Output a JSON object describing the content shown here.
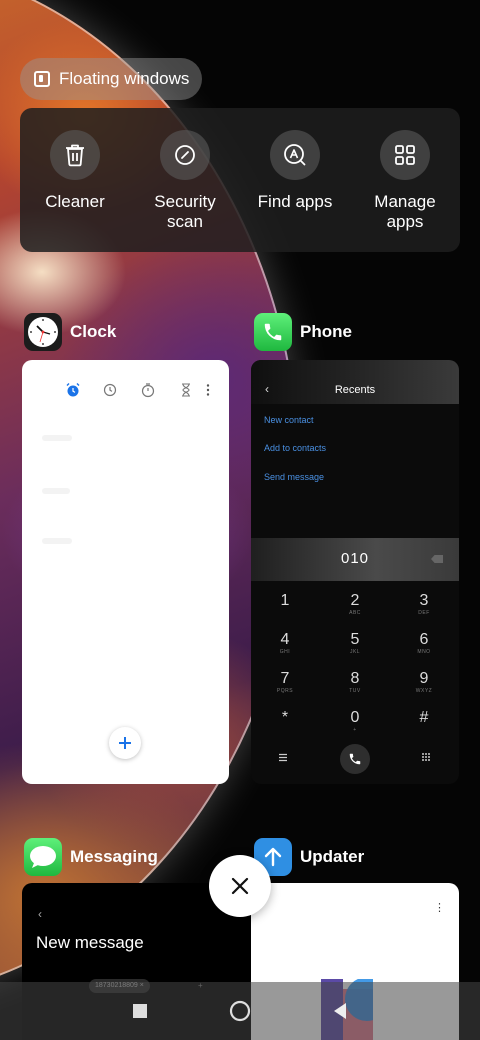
{
  "floating_windows": {
    "label": "Floating windows"
  },
  "quick_actions": [
    {
      "label": "Cleaner",
      "icon": "trash-icon"
    },
    {
      "label": "Security\nscan",
      "icon": "security-scan-icon"
    },
    {
      "label": "Find apps",
      "icon": "find-apps-icon"
    },
    {
      "label": "Manage\napps",
      "icon": "grid-icon"
    }
  ],
  "recent_apps": {
    "clock": {
      "title": "Clock"
    },
    "phone": {
      "title": "Phone",
      "screen_title": "Recents",
      "links": [
        "New contact",
        "Add to contacts",
        "Send message"
      ],
      "dialed_number": "010",
      "keypad": [
        {
          "num": "1",
          "letters": ""
        },
        {
          "num": "2",
          "letters": "ABC"
        },
        {
          "num": "3",
          "letters": "DEF"
        },
        {
          "num": "4",
          "letters": "GHI"
        },
        {
          "num": "5",
          "letters": "JKL"
        },
        {
          "num": "6",
          "letters": "MNO"
        },
        {
          "num": "7",
          "letters": "PQRS"
        },
        {
          "num": "8",
          "letters": "TUV"
        },
        {
          "num": "9",
          "letters": "WXYZ"
        },
        {
          "num": "*",
          "letters": ""
        },
        {
          "num": "0",
          "letters": "+"
        },
        {
          "num": "#",
          "letters": ""
        }
      ]
    },
    "messaging": {
      "title": "Messaging",
      "screen_title": "New message",
      "recipient_chip": "18730218809"
    },
    "updater": {
      "title": "Updater"
    }
  },
  "colors": {
    "clock_icon_bg": "#1c1c1c",
    "phone_icon_bg": "#34c759",
    "messaging_icon_bg": "#34c759",
    "updater_icon_bg": "#2f8fe3",
    "link_blue": "#4a90e2",
    "accent_blue": "#1a73e8"
  }
}
